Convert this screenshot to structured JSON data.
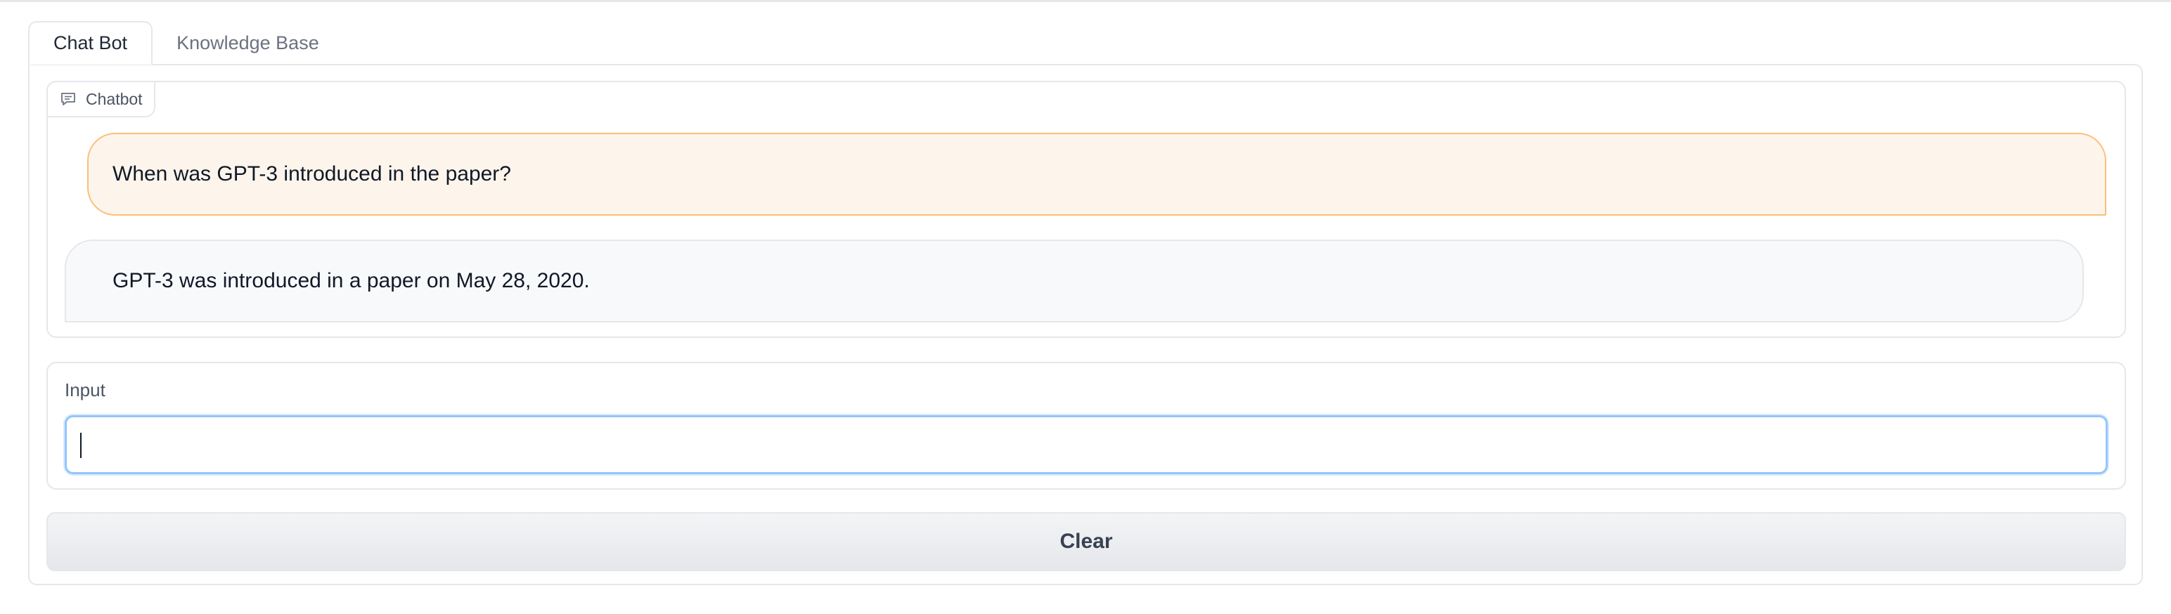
{
  "tabs": [
    {
      "label": "Chat Bot",
      "active": true
    },
    {
      "label": "Knowledge Base",
      "active": false
    }
  ],
  "chatbot": {
    "label": "Chatbot",
    "icon": "chat-bubble-icon",
    "messages": [
      {
        "role": "user",
        "text": "When was GPT-3 introduced in the paper?"
      },
      {
        "role": "bot",
        "text": "GPT-3 was introduced in a paper on May 28, 2020."
      }
    ]
  },
  "input": {
    "label": "Input",
    "value": "",
    "placeholder": ""
  },
  "clear_button": {
    "label": "Clear"
  },
  "colors": {
    "user_bubble_bg": "#fdf5eb",
    "user_bubble_border": "#fbbf77",
    "bot_bubble_bg": "#f8f9fb",
    "input_focus_border": "#93c5fd"
  }
}
